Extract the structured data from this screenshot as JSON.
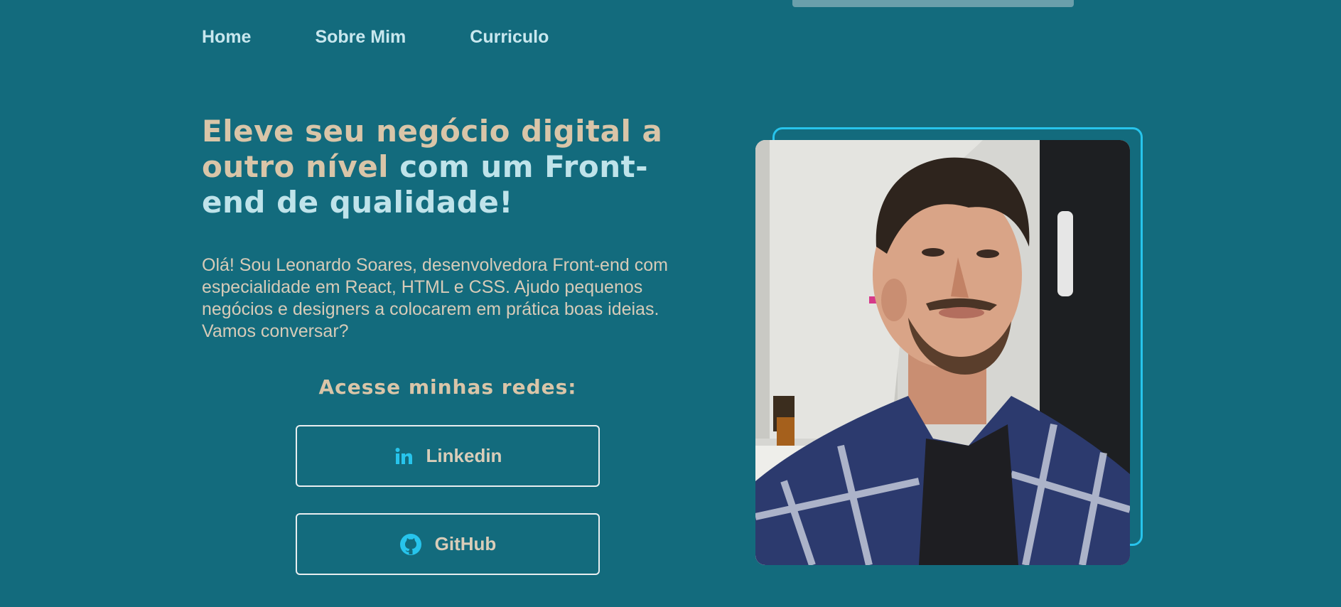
{
  "nav": {
    "items": [
      {
        "label": "Home"
      },
      {
        "label": "Sobre Mim"
      },
      {
        "label": "Curriculo"
      }
    ]
  },
  "hero": {
    "title_accent": "Eleve seu negócio digital a outro nível",
    "title_light": "com um Front-end de qualidade!",
    "intro": "Olá! Sou Leonardo Soares, desenvolvedora Front-end com especialidade em React, HTML e CSS. Ajudo pequenos negócios e designers a colocarem em prática boas ideias. Vamos conversar?"
  },
  "social": {
    "heading": "Acesse minhas redes:",
    "buttons": [
      {
        "label": "Linkedin",
        "icon": "linkedin-icon"
      },
      {
        "label": "GitHub",
        "icon": "github-icon"
      }
    ]
  },
  "profile_photo": {
    "subject": "portrait-photo"
  },
  "colors": {
    "background": "#136b7d",
    "accent_text": "#d9c5a8",
    "light_text": "#bfe3ea",
    "frame_border": "#27c4ec",
    "icon": "#27c4ec"
  }
}
